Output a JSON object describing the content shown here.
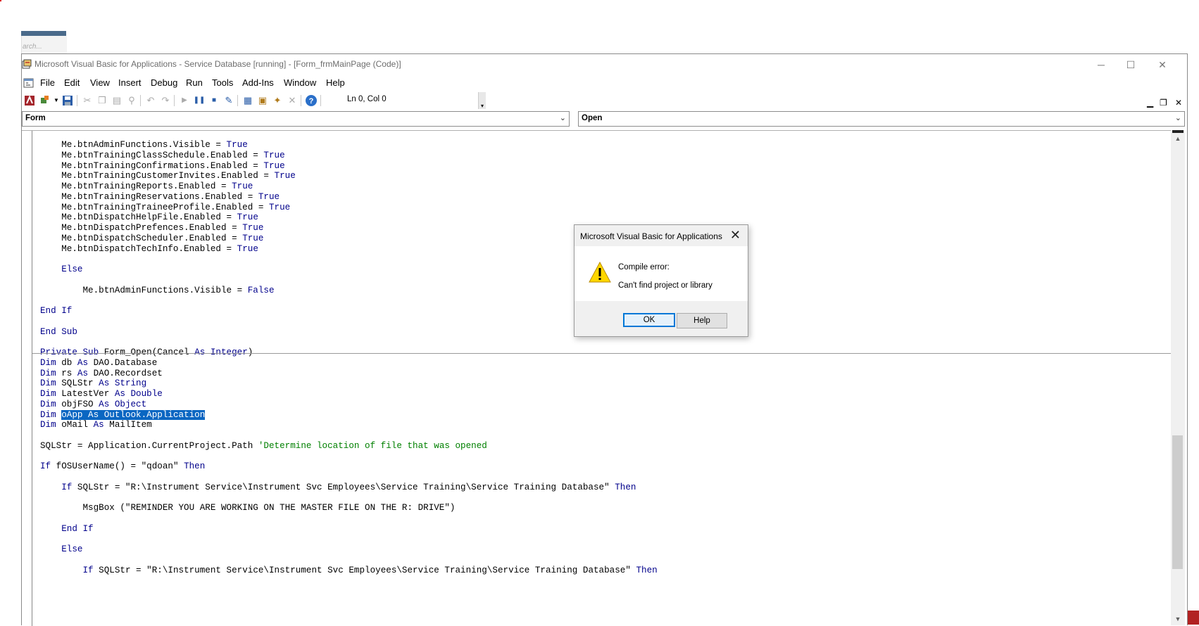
{
  "background": {
    "search_placeholder": "arch..."
  },
  "window": {
    "title": "Microsoft Visual Basic for Applications - Service Database [running] - [Form_frmMainPage (Code)]",
    "minimize_glyph": "─",
    "maximize_glyph": "☐",
    "close_glyph": "✕",
    "mdi_minimize_glyph": "▁",
    "mdi_restore_glyph": "❐",
    "mdi_close_glyph": "✕"
  },
  "menu": {
    "items": [
      {
        "label": "File"
      },
      {
        "label": "Edit"
      },
      {
        "label": "View"
      },
      {
        "label": "Insert"
      },
      {
        "label": "Debug"
      },
      {
        "label": "Run"
      },
      {
        "label": "Tools"
      },
      {
        "label": "Add-Ins"
      },
      {
        "label": "Window"
      },
      {
        "label": "Help"
      }
    ]
  },
  "toolbar": {
    "status": "Ln 0, Col 0"
  },
  "combos": {
    "object": "Form",
    "procedure": "Open"
  },
  "code": {
    "lines": [
      {
        "text": "    Me.btnAdminFunctions.Visible = ",
        "kw": "True"
      },
      {
        "text": "    Me.btnTrainingClassSchedule.Enabled = ",
        "kw": "True"
      },
      {
        "text": "    Me.btnTrainingConfirmations.Enabled = ",
        "kw": "True"
      },
      {
        "text": "    Me.btnTrainingCustomerInvites.Enabled = ",
        "kw": "True"
      },
      {
        "text": "    Me.btnTrainingReports.Enabled = ",
        "kw": "True"
      },
      {
        "text": "    Me.btnTrainingReservations.Enabled = ",
        "kw": "True"
      },
      {
        "text": "    Me.btnTrainingTraineeProfile.Enabled = ",
        "kw": "True"
      },
      {
        "text": "    Me.btnDispatchHelpFile.Enabled = ",
        "kw": "True"
      },
      {
        "text": "    Me.btnDispatchPrefences.Enabled = ",
        "kw": "True"
      },
      {
        "text": "    Me.btnDispatchScheduler.Enabled = ",
        "kw": "True"
      },
      {
        "text": "    Me.btnDispatchTechInfo.Enabled = ",
        "kw": "True"
      },
      {
        "text": ""
      },
      {
        "text": "    ",
        "kw": "Else"
      },
      {
        "text": ""
      },
      {
        "text": "        Me.btnAdminFunctions.Visible = ",
        "kw": "False"
      },
      {
        "text": ""
      },
      {
        "text": "",
        "kw": "End If"
      },
      {
        "text": ""
      },
      {
        "text": "",
        "kw": "End Sub"
      }
    ],
    "proc2_lines": [
      {
        "kw": "Private Sub",
        "text": " Form_Open(Cancel ",
        "kw2": "As Integer",
        "text2": ")"
      },
      {
        "kw": "Dim",
        "text": " db ",
        "kw2": "As",
        "text2": " DAO.Database"
      },
      {
        "kw": "Dim",
        "text": " rs ",
        "kw2": "As",
        "text2": " DAO.Recordset"
      },
      {
        "kw": "Dim",
        "text": " SQLStr ",
        "kw2": "As String",
        "text2": ""
      },
      {
        "kw": "Dim",
        "text": " LatestVer ",
        "kw2": "As Double",
        "text2": ""
      },
      {
        "kw": "Dim",
        "text": " objFSO ",
        "kw2": "As Object",
        "text2": ""
      },
      {
        "kw": "Dim",
        "text": " ",
        "sel": "oApp As Outlook.Application"
      },
      {
        "kw": "Dim",
        "text": " oMail ",
        "kw2": "As",
        "text2": " MailItem"
      },
      {
        "text": ""
      },
      {
        "text": "SQLStr = Application.CurrentProject.Path ",
        "comment": "'Determine location of file that was opened"
      },
      {
        "text": ""
      },
      {
        "kw": "If",
        "text": " fOSUserName() = \"qdoan\" ",
        "kw2": "Then",
        "text2": ""
      },
      {
        "text": ""
      },
      {
        "pre": "    ",
        "kw": "If",
        "text": " SQLStr = \"R:\\Instrument Service\\Instrument Svc Employees\\Service Training\\Service Training Database\" ",
        "kw2": "Then",
        "text2": ""
      },
      {
        "text": ""
      },
      {
        "text": "        MsgBox (\"REMINDER YOU ARE WORKING ON THE MASTER FILE ON THE R: DRIVE\")"
      },
      {
        "text": ""
      },
      {
        "pre": "    ",
        "kw": "End If",
        "text": ""
      },
      {
        "text": ""
      },
      {
        "pre": "    ",
        "kw": "Else",
        "text": ""
      },
      {
        "text": ""
      },
      {
        "pre": "        ",
        "kw": "If",
        "text": " SQLStr = \"R:\\Instrument Service\\Instrument Svc Employees\\Service Training\\Service Training Database\" ",
        "kw2": "Then",
        "text2": ""
      }
    ]
  },
  "dialog": {
    "title": "Microsoft Visual Basic for Applications",
    "heading": "Compile error:",
    "message": "Can't find project or library",
    "ok": "OK",
    "help": "Help"
  },
  "colors": {
    "keyword": "#00008b",
    "comment": "#008000",
    "selection": "#0a66c2",
    "warning": "#ffd700"
  }
}
